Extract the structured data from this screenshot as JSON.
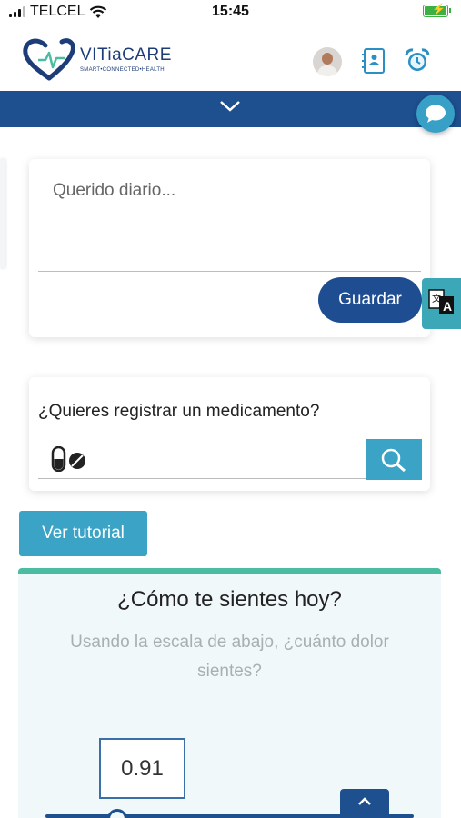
{
  "status_bar": {
    "carrier": "TELCEL",
    "time": "15:45"
  },
  "brand": {
    "name": "VITiaCARE",
    "tagline": "SMART•CONNECTED•HEALTH"
  },
  "header": {
    "icons": [
      "avatar",
      "contacts-icon",
      "alarm-clock-icon"
    ]
  },
  "diary": {
    "placeholder": "Querido diario...",
    "save_label": "Guardar"
  },
  "medication": {
    "question": "¿Quieres registrar un medicamento?",
    "icon": "pills-icon",
    "search_icon": "search-icon"
  },
  "tutorial": {
    "label": "Ver tutorial"
  },
  "feeling": {
    "title": "¿Cómo te sientes hoy?",
    "subtitle": "Usando la escala de abajo, ¿cuánto dolor sientes?",
    "value": "0.91"
  },
  "colors": {
    "primary": "#1e4f8f",
    "accent": "#3ba3c6",
    "teal": "#4bbba2"
  }
}
